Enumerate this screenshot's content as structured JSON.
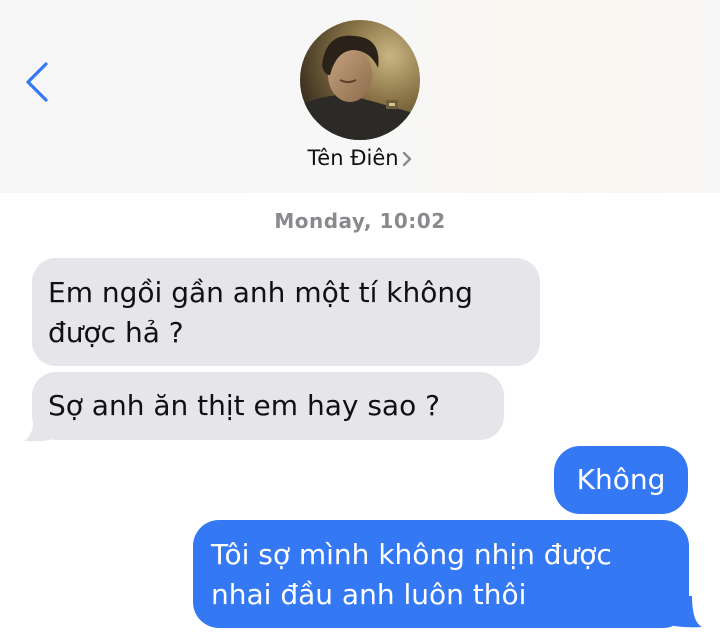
{
  "header": {
    "contact_name": "Tên Điên",
    "avatar_icon": "contact-photo",
    "back_icon": "chevron-left-icon",
    "accent_color": "#3479f3"
  },
  "conversation": {
    "timestamp": "Monday, 10:02",
    "messages": [
      {
        "direction": "incoming",
        "lines": [
          "Em ngồi gần anh một tí không",
          "được hả ?"
        ]
      },
      {
        "direction": "incoming",
        "lines": [
          "Sợ anh ăn thịt em hay sao ?"
        ]
      },
      {
        "direction": "outgoing",
        "lines": [
          "Không"
        ]
      },
      {
        "direction": "outgoing",
        "lines": [
          "Tôi sợ mình không nhịn được",
          "nhai đầu anh luôn thôi"
        ]
      }
    ]
  },
  "colors": {
    "incoming_bubble": "#e5e5ea",
    "outgoing_bubble": "#3479f3",
    "timestamp_text": "#8a8a8e"
  }
}
